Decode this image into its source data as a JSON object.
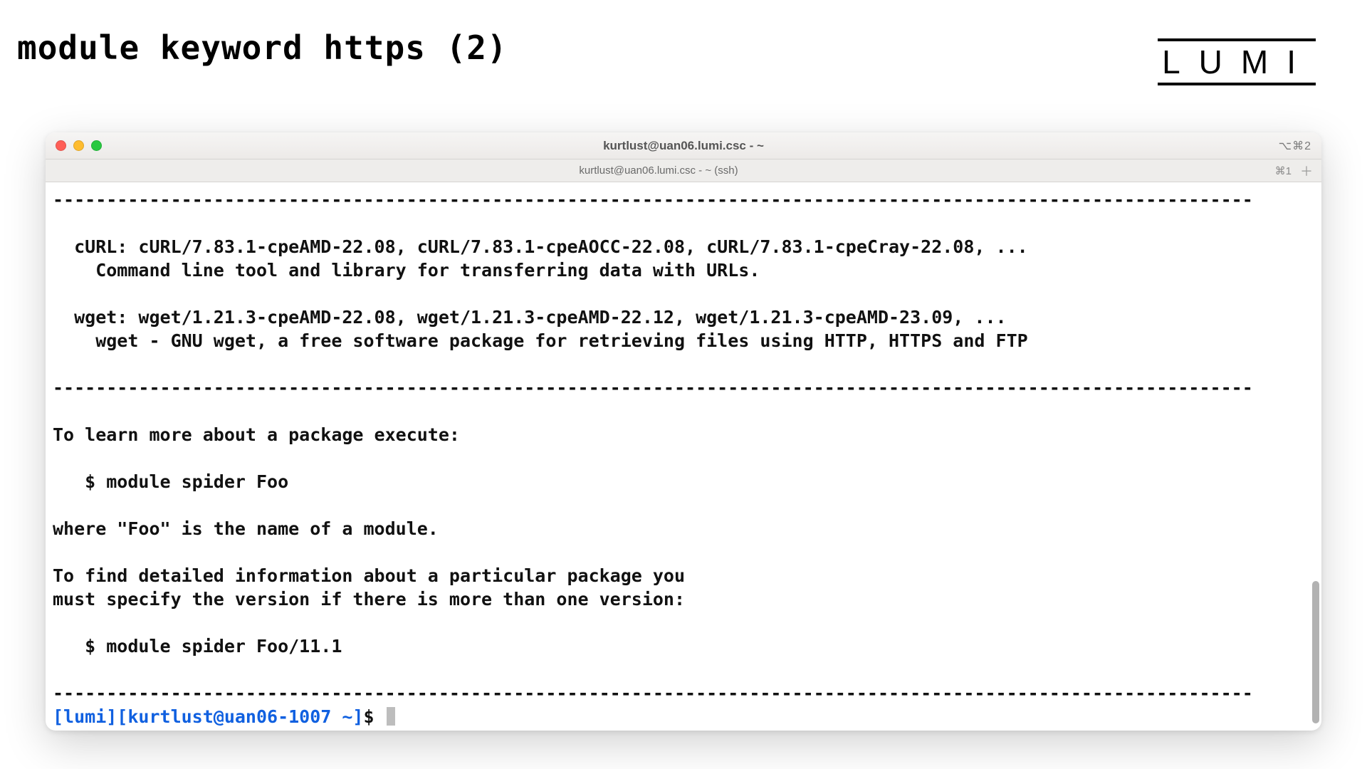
{
  "slide": {
    "title": "module keyword https (2)",
    "logo_text": "LUMI"
  },
  "window": {
    "title": "kurtlust@uan06.lumi.csc - ~",
    "tab_label": "kurtlust@uan06.lumi.csc - ~ (ssh)",
    "titlebar_right": "⌥⌘2",
    "tabbar_right_label": "⌘1"
  },
  "terminal": {
    "sep": "----------------------------------------------------------------------------------------------------------------",
    "curl_line": "  cURL: cURL/7.83.1-cpeAMD-22.08, cURL/7.83.1-cpeAOCC-22.08, cURL/7.83.1-cpeCray-22.08, ...",
    "curl_desc": "    Command line tool and library for transferring data with URLs.",
    "wget_line": "  wget: wget/1.21.3-cpeAMD-22.08, wget/1.21.3-cpeAMD-22.12, wget/1.21.3-cpeAMD-23.09, ...",
    "wget_desc": "    wget - GNU wget, a free software package for retrieving files using HTTP, HTTPS and FTP",
    "learn_line": "To learn more about a package execute:",
    "spider1": "   $ module spider Foo",
    "where_line": "where \"Foo\" is the name of a module.",
    "detail_line1": "To find detailed information about a particular package you",
    "detail_line2": "must specify the version if there is more than one version:",
    "spider2": "   $ module spider Foo/11.1",
    "prompt_host": "[lumi][kurtlust@uan06-1007 ~]",
    "prompt_tail": "$ "
  }
}
